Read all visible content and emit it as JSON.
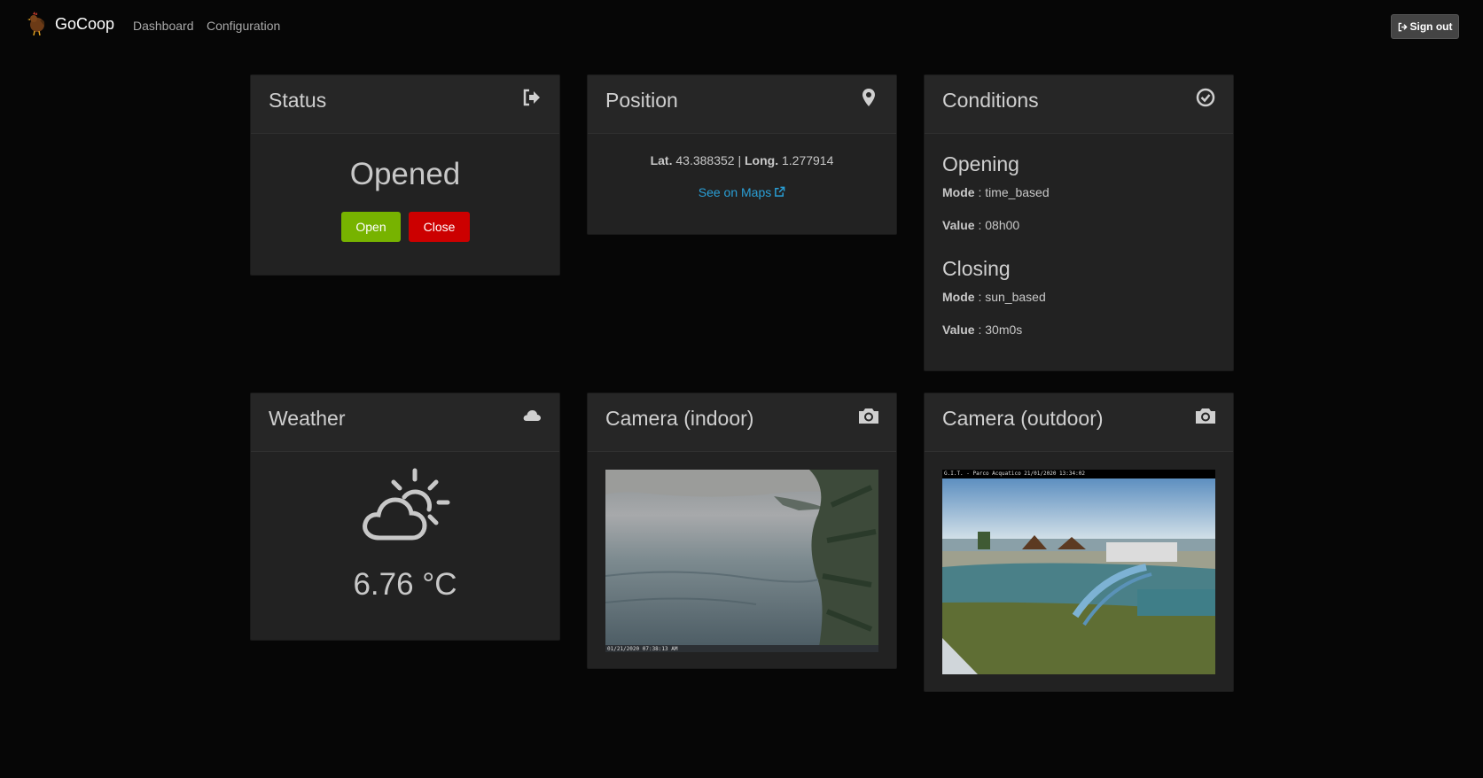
{
  "app": {
    "brand": "GoCoop",
    "nav": [
      "Dashboard",
      "Configuration"
    ],
    "sign_out": "Sign out"
  },
  "status": {
    "title": "Status",
    "icon": "sign-out-icon",
    "state": "Opened",
    "open_label": "Open",
    "close_label": "Close",
    "open_color": "#77b300",
    "close_color": "#cc0000"
  },
  "position": {
    "title": "Position",
    "icon": "map-marker-icon",
    "lat_label": "Lat.",
    "lat": "43.388352",
    "separator": "|",
    "long_label": "Long.",
    "long": "1.277914",
    "maps_link": "See on Maps",
    "link_color": "#2a9fd6"
  },
  "conditions": {
    "title": "Conditions",
    "icon": "check-circle-icon",
    "opening": {
      "heading": "Opening",
      "mode_label": "Mode",
      "mode": "time_based",
      "value_label": "Value",
      "value": "08h00"
    },
    "closing": {
      "heading": "Closing",
      "mode_label": "Mode",
      "mode": "sun_based",
      "value_label": "Value",
      "value": "30m0s"
    }
  },
  "weather": {
    "title": "Weather",
    "icon": "cloud-icon",
    "condition_icon": "partly-cloudy-icon",
    "temperature": "6.76 °C"
  },
  "camera_indoor": {
    "title": "Camera (indoor)",
    "icon": "camera-icon",
    "timestamp": "01/21/2020 07:38:13 AM"
  },
  "camera_outdoor": {
    "title": "Camera (outdoor)",
    "icon": "camera-icon",
    "caption": "G.I.T. - Parco Acquatico 21/01/2020 13:34:02"
  }
}
